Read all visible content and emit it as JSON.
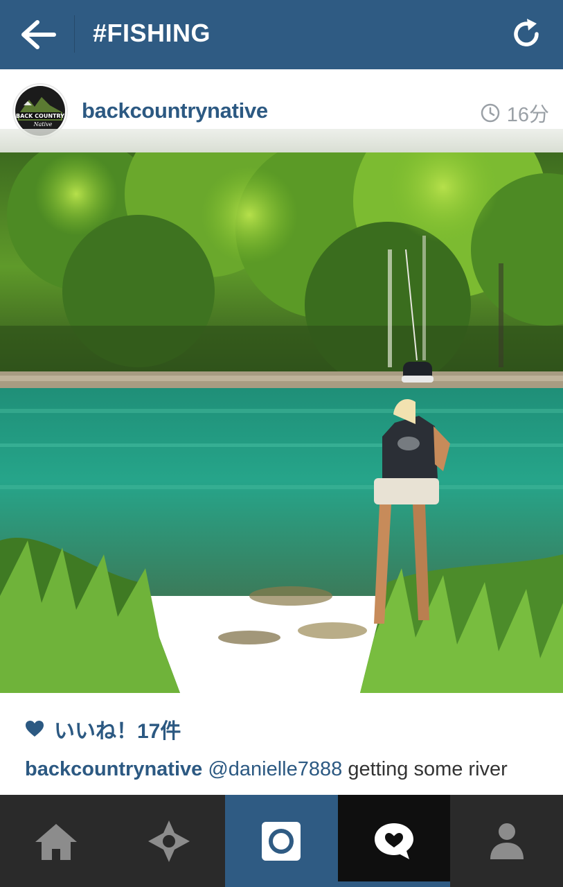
{
  "header": {
    "title": "#FISHING"
  },
  "post": {
    "username": "backcountrynative",
    "time": "16分",
    "likes_label": "いいね！17件",
    "caption": {
      "username": "backcountrynative",
      "mention": "@danielle7888",
      "text": " getting some river"
    }
  },
  "nav": {
    "items": [
      "home-icon",
      "explore-icon",
      "camera-icon",
      "activity-icon",
      "profile-icon"
    ]
  },
  "colors": {
    "brand": "#2f5b83",
    "nav_bg": "#2a2a2a"
  }
}
